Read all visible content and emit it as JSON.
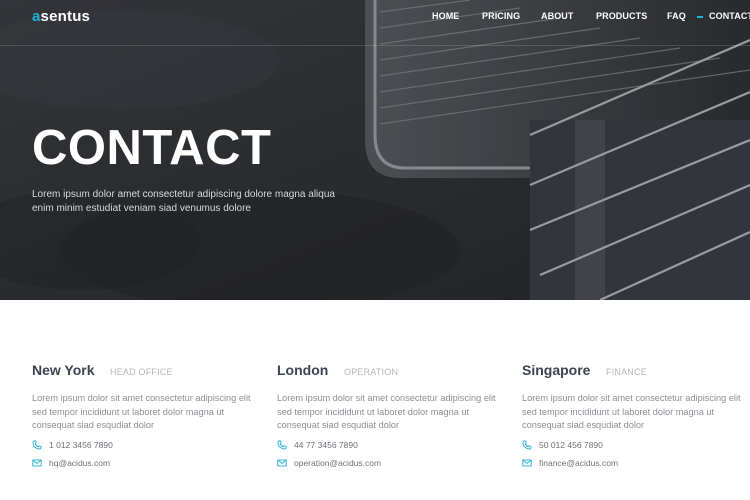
{
  "brand": {
    "logo_accent": "a",
    "logo_rest": "sentus",
    "accent_color": "#23b0d3"
  },
  "nav": {
    "items": [
      {
        "label": "HOME"
      },
      {
        "label": "PRICING"
      },
      {
        "label": "ABOUT"
      },
      {
        "label": "PRODUCTS"
      },
      {
        "label": "FAQ"
      },
      {
        "label": "CONTACT",
        "active": true
      }
    ]
  },
  "hero": {
    "title": "CONTACT",
    "subtitle": "Lorem ipsum dolor amet consectetur adipiscing dolore magna aliqua enim minim estudiat veniam siad venumus dolore"
  },
  "offices": [
    {
      "city": "New York",
      "role": "HEAD OFFICE",
      "description": "Lorem ipsum dolor sit amet consectetur adipiscing elit sed tempor incididunt ut laboret dolor magna ut consequat siad esqudiat dolor",
      "phone": "1 012 3456 7890",
      "email": "hq@acidus.com"
    },
    {
      "city": "London",
      "role": "OPERATION",
      "description": "Lorem ipsum dolor sit amet consectetur adipiscing elit sed tempor incididunt ut laboret dolor magna ut consequat siad esqudiat dolor",
      "phone": "44 77 3456 7890",
      "email": "operation@acidus.com"
    },
    {
      "city": "Singapore",
      "role": "FINANCE",
      "description": "Lorem ipsum dolor sit amet consectetur adipiscing elit sed tempor incididunt ut laboret dolor magna ut consequat siad esqudiat dolor",
      "phone": "50 012 456 7890",
      "email": "finance@acidus.com"
    }
  ],
  "icons": {
    "phone": "phone-icon",
    "email": "envelope-icon"
  }
}
